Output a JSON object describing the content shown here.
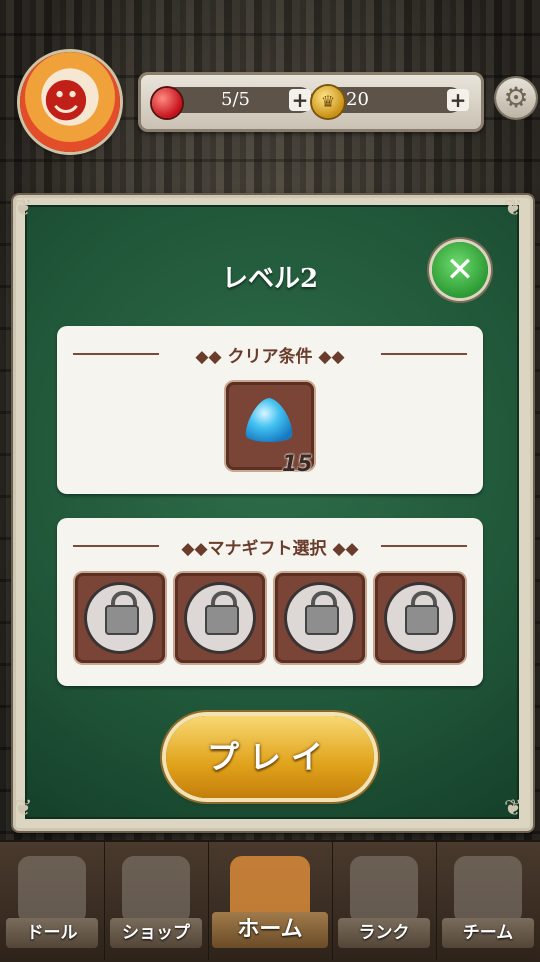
{
  "header": {
    "hearts": "5/5",
    "coins": "20",
    "plus_label": "+"
  },
  "dialog": {
    "title": "レベル2",
    "close_label": "✕",
    "clear_conditions": {
      "label": "◆◆ クリア条件 ◆◆",
      "goal_count": "15"
    },
    "mana_gift": {
      "label": "◆◆マナギフト選択 ◆◆"
    },
    "play_label": "プレイ"
  },
  "nav": {
    "items": [
      {
        "label": "ドール"
      },
      {
        "label": "ショップ"
      },
      {
        "label": "ホーム"
      },
      {
        "label": "ランク"
      },
      {
        "label": "チーム"
      }
    ]
  },
  "colors": {
    "dialog_green": "#1e5236",
    "play_gold": "#e0a21a",
    "close_green": "#2d9b34",
    "tile_brown": "#7a4536"
  }
}
